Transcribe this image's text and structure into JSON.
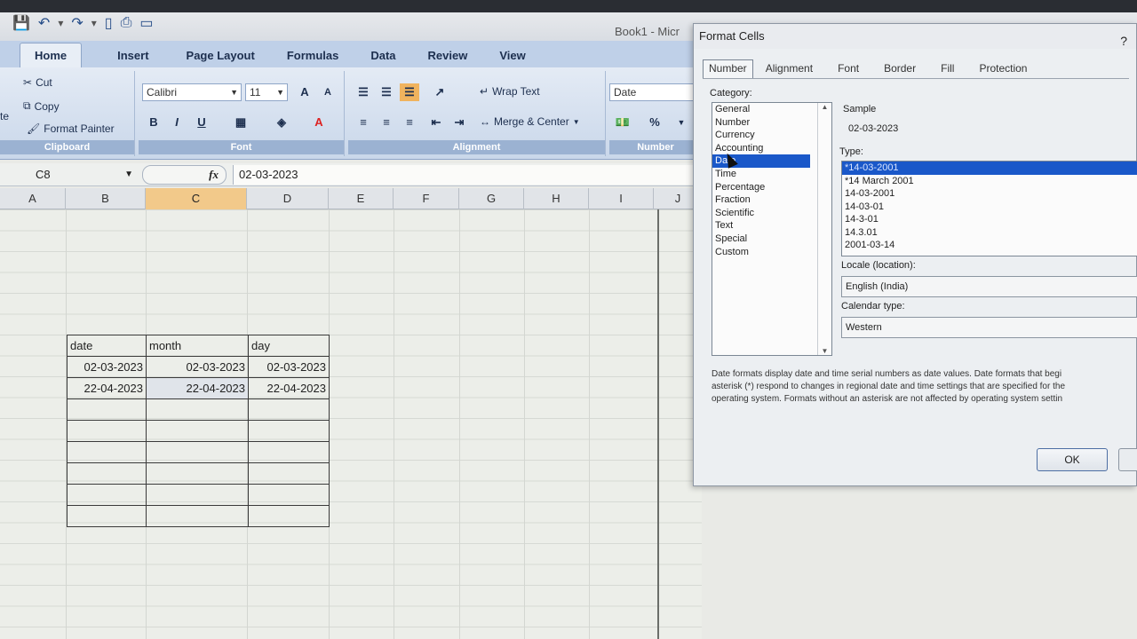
{
  "window": {
    "title": "Book1 - Micr"
  },
  "qat": [
    "save-icon",
    "undo-icon",
    "redo-icon",
    "new-icon",
    "print-icon",
    "preview-icon"
  ],
  "ribbon": {
    "tabs": [
      "Home",
      "Insert",
      "Page Layout",
      "Formulas",
      "Data",
      "Review",
      "View"
    ],
    "clipboard": {
      "cut": "Cut",
      "copy": "Copy",
      "format_painter": "Format Painter",
      "label": "Clipboard",
      "paste_partial": "te"
    },
    "font": {
      "name": "Calibri",
      "size": "11",
      "label": "Font",
      "bold": "B",
      "italic": "I",
      "underline": "U",
      "grow": "A",
      "shrink": "A",
      "color": "A"
    },
    "alignment": {
      "wrap": "Wrap Text",
      "merge": "Merge & Center",
      "label": "Alignment"
    },
    "number": {
      "format": "Date",
      "label": "Number",
      "percent": "%"
    }
  },
  "formula_bar": {
    "name_box": "C8",
    "fx": "fx",
    "value": "02-03-2023"
  },
  "columns": [
    "A",
    "B",
    "C",
    "D",
    "E",
    "F",
    "G",
    "H",
    "I",
    "J"
  ],
  "selected_column": "C",
  "sheet_table": {
    "headers": [
      "date",
      "month",
      "day"
    ],
    "rows": [
      [
        "02-03-2023",
        "02-03-2023",
        "02-03-2023"
      ],
      [
        "22-04-2023",
        "22-04-2023",
        "22-04-2023"
      ]
    ],
    "empty_rows": 6
  },
  "dialog": {
    "title": "Format Cells",
    "help": "?",
    "tabs": [
      "Number",
      "Alignment",
      "Font",
      "Border",
      "Fill",
      "Protection"
    ],
    "category_label": "Category:",
    "categories": [
      "General",
      "Number",
      "Currency",
      "Accounting",
      "Date",
      "Time",
      "Percentage",
      "Fraction",
      "Scientific",
      "Text",
      "Special",
      "Custom"
    ],
    "selected_category": "Date",
    "sample_label": "Sample",
    "sample_value": "02-03-2023",
    "type_label": "Type:",
    "types": [
      "*14-03-2001",
      "*14 March 2001",
      "14-03-2001",
      "14-03-01",
      "14-3-01",
      "14.3.01",
      "2001-03-14"
    ],
    "locale_label": "Locale (location):",
    "locale_value": "English (India)",
    "calendar_label": "Calendar type:",
    "calendar_value": "Western",
    "description": [
      "Date formats display date and time serial numbers as date values.  Date formats that begi",
      "asterisk (*) respond to changes in regional date and time settings that are specified for the",
      "operating system. Formats without an asterisk are not affected by operating system settin"
    ],
    "ok": "OK"
  }
}
